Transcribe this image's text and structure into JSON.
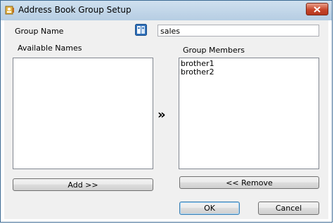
{
  "window": {
    "title": "Address Book Group Setup"
  },
  "form": {
    "group_name_label": "Group Name",
    "group_name_value": "sales",
    "available_names_label": "Available Names",
    "group_members_label": "Group Members",
    "available_names": [],
    "group_members": [
      "brother1",
      "brother2"
    ],
    "transfer_arrow": "»"
  },
  "buttons": {
    "add": "Add >>",
    "remove": "<< Remove",
    "ok": "OK",
    "cancel": "Cancel"
  },
  "icons": {
    "title": "address-book-icon",
    "group": "address-book-group-icon",
    "close": "close-icon"
  }
}
